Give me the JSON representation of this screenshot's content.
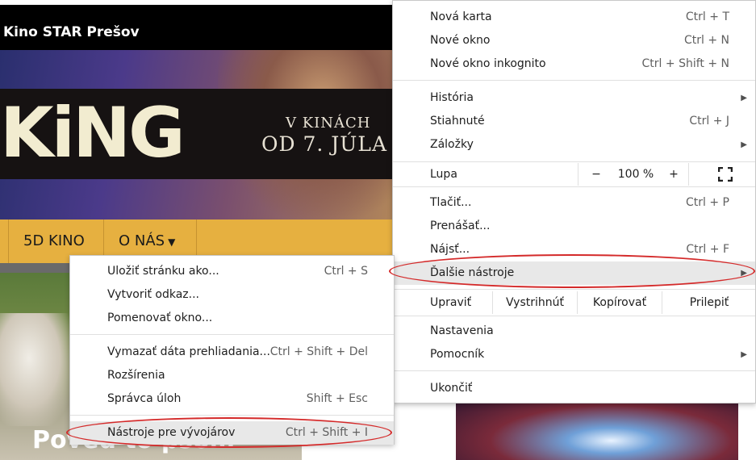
{
  "site": {
    "title": "Kino STAR Prešov",
    "banner": {
      "logo": "KiNG",
      "line1": "V KINÁCH",
      "line2": "OD 7. JÚLA"
    },
    "nav": [
      {
        "label": "5D KINO"
      },
      {
        "label": "O NÁS"
      }
    ],
    "photo_caption": "Poveď to psom"
  },
  "menu": {
    "new_tab": {
      "label": "Nová karta",
      "shortcut": "Ctrl + T"
    },
    "new_window": {
      "label": "Nové okno",
      "shortcut": "Ctrl + N"
    },
    "incognito": {
      "label": "Nové okno inkognito",
      "shortcut": "Ctrl + Shift + N"
    },
    "history": {
      "label": "História"
    },
    "downloads": {
      "label": "Stiahnuté",
      "shortcut": "Ctrl + J"
    },
    "bookmarks": {
      "label": "Záložky"
    },
    "zoom": {
      "label": "Lupa",
      "minus": "−",
      "value": "100 %",
      "plus": "+"
    },
    "print": {
      "label": "Tlačiť...",
      "shortcut": "Ctrl + P"
    },
    "cast": {
      "label": "Prenášať..."
    },
    "find": {
      "label": "Nájsť...",
      "shortcut": "Ctrl + F"
    },
    "more_tools": {
      "label": "Ďalšie nástroje"
    },
    "edit": {
      "label": "Upraviť",
      "cut": "Vystrihnúť",
      "copy": "Kopírovať",
      "paste": "Prilepiť"
    },
    "settings": {
      "label": "Nastavenia"
    },
    "help": {
      "label": "Pomocník"
    },
    "exit": {
      "label": "Ukončiť"
    }
  },
  "submenu": {
    "save_page": {
      "label": "Uložiť stránku ako...",
      "shortcut": "Ctrl + S"
    },
    "create_shortcut": {
      "label": "Vytvoriť odkaz..."
    },
    "name_window": {
      "label": "Pomenovať okno..."
    },
    "clear_data": {
      "label": "Vymazať dáta prehliadania...",
      "shortcut": "Ctrl + Shift + Del"
    },
    "extensions": {
      "label": "Rozšírenia"
    },
    "task_manager": {
      "label": "Správca úloh",
      "shortcut": "Shift + Esc"
    },
    "dev_tools": {
      "label": "Nástroje pre vývojárov",
      "shortcut": "Ctrl + Shift + I"
    }
  },
  "colors": {
    "nav_bg": "#e6b040",
    "highlight": "#e8e8e8",
    "annotation": "#d42a2a"
  },
  "icons": {
    "submenu_arrow": "triangle-right-icon",
    "fullscreen": "fullscreen-icon",
    "dropdown": "chevron-down-icon"
  }
}
